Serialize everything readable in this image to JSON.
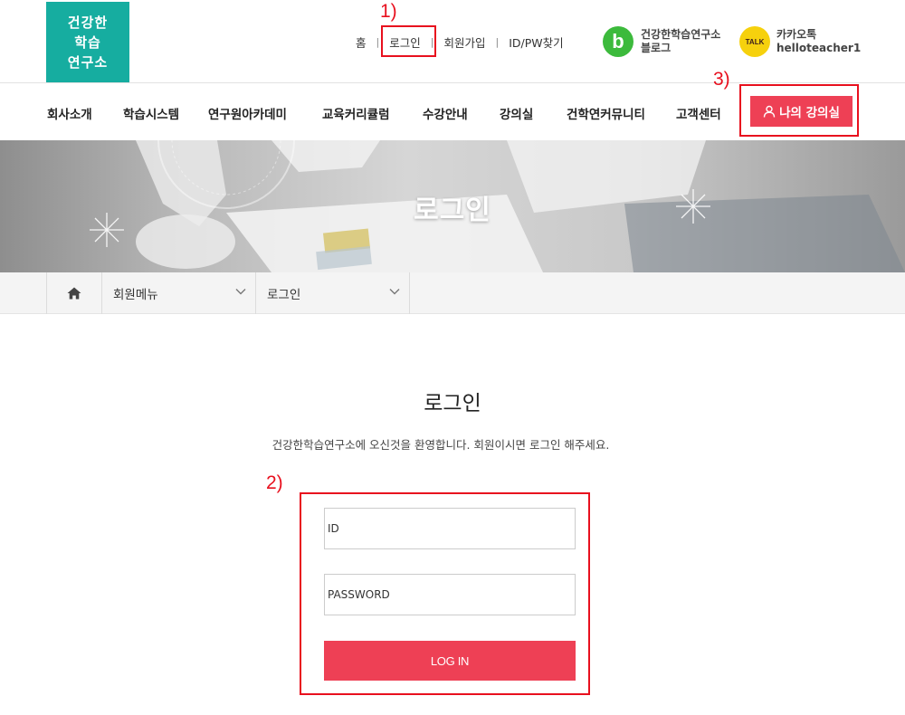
{
  "logo": {
    "lines": [
      "건강한",
      "학습",
      "연구소"
    ]
  },
  "utility_nav": {
    "items": [
      "홈",
      "로그인",
      "회원가입",
      "ID/PW찾기"
    ],
    "separator": "|"
  },
  "blog": {
    "icon_letter": "b",
    "line1": "건강한학습연구소",
    "line2": "블로그"
  },
  "kakao": {
    "icon_text": "TALK",
    "line1": "카카오톡",
    "line2": "helloteacher1"
  },
  "main_nav": {
    "items": [
      "회사소개",
      "학습시스템",
      "연구원아카데미",
      "교육커리큘럼",
      "수강안내",
      "강의실",
      "건학연커뮤니티",
      "고객센터"
    ],
    "my_classroom": "나의 강의실"
  },
  "hero": {
    "title": "로그인"
  },
  "breadcrumb": {
    "level1": "회원메뉴",
    "level2": "로그인"
  },
  "login": {
    "title": "로그인",
    "subtitle": "건강한학습연구소에 오신것을 환영합니다. 회원이시면 로그인 해주세요.",
    "id_placeholder": "ID",
    "password_placeholder": "PASSWORD",
    "button": "LOG IN"
  },
  "annotations": {
    "label1": "1)",
    "label2": "2)",
    "label3": "3)"
  },
  "colors": {
    "brand_teal": "#16ada0",
    "accent_red": "#ee4055",
    "annotation_red": "#e8101e",
    "blog_green": "#3cba3c",
    "kakao_yellow": "#f6d10d"
  },
  "icons": {
    "breadcrumb_home": "home-icon",
    "dropdown": "chevron-down-icon",
    "my_classroom": "user-icon"
  }
}
